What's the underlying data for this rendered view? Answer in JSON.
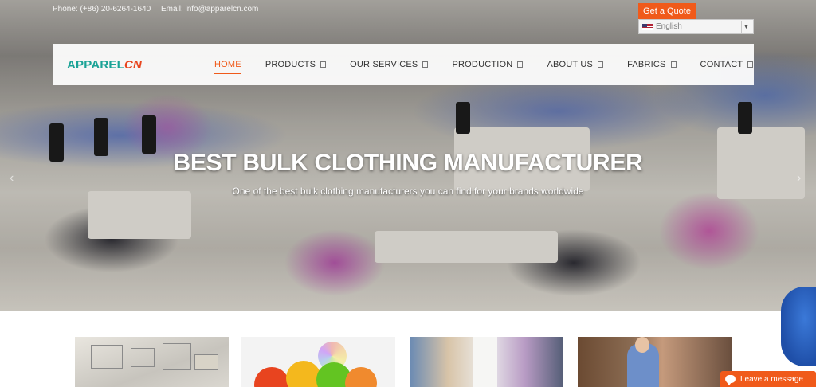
{
  "topbar": {
    "phone": "Phone: (+86) 20-6264-1640",
    "email": "Email: info@apparelcn.com"
  },
  "quote_button": {
    "label": "Get a Quote"
  },
  "language": {
    "selected": "English",
    "icon": "us-flag-icon"
  },
  "logo": {
    "part1": "APPAREL",
    "part2": "CN"
  },
  "nav": {
    "items": [
      {
        "label": "HOME",
        "active": true
      },
      {
        "label": "PRODUCTS",
        "has_dropdown": true
      },
      {
        "label": "OUR SERVICES",
        "has_dropdown": true
      },
      {
        "label": "PRODUCTION",
        "has_dropdown": true
      },
      {
        "label": "ABOUT US",
        "has_dropdown": true
      },
      {
        "label": "FABRICS",
        "has_dropdown": true
      },
      {
        "label": "CONTACT",
        "has_dropdown": true
      }
    ]
  },
  "hero": {
    "title": "BEST BULK CLOTHING MANUFACTURER",
    "subtitle": "One of the best bulk clothing manufacturers you can find for your brands worldwide"
  },
  "chat": {
    "label": "Leave a message",
    "icon": "chat-bubble-icon"
  },
  "colors": {
    "accent": "#f05a1a",
    "logo_teal": "#1aa396",
    "logo_red": "#e8451e"
  }
}
